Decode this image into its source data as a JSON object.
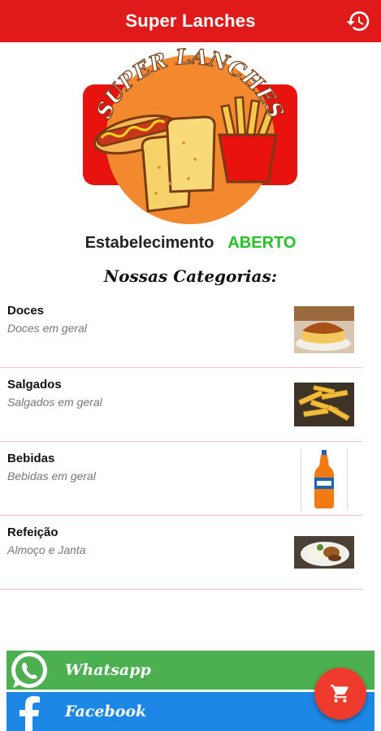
{
  "app": {
    "title": "Super Lanches"
  },
  "logo": {
    "text": "SUPER LANCHES"
  },
  "status": {
    "label": "Estabelecimento",
    "value": "ABERTO",
    "color": "#22c322"
  },
  "categories_heading": "Nossas Categorias:",
  "categories": [
    {
      "name": "Doces",
      "description": "Doces em geral",
      "image": "flan-pudding-image"
    },
    {
      "name": "Salgados",
      "description": "Salgados em geral",
      "image": "french-fries-image"
    },
    {
      "name": "Bebidas",
      "description": "Bebidas em geral",
      "image": "soda-bottle-image"
    },
    {
      "name": "Refeição",
      "description": "Almoço e Janta",
      "image": "meal-plate-image"
    }
  ],
  "social": {
    "whatsapp_label": "Whatsapp",
    "facebook_label": "Facebook"
  },
  "colors": {
    "appbar": "#e01a1a",
    "whatsapp": "#4caf50",
    "facebook": "#1d87e5",
    "fab": "#ee3b2e"
  },
  "icons": {
    "history": "history-icon",
    "cart": "cart-icon",
    "whatsapp": "whatsapp-icon",
    "facebook": "facebook-icon"
  }
}
